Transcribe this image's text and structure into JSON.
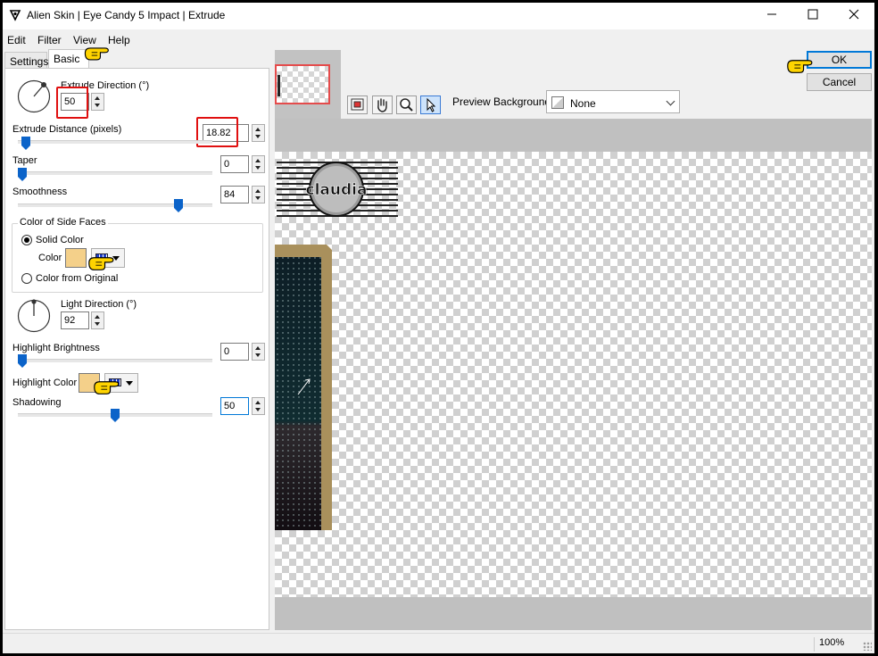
{
  "window": {
    "title": "Alien Skin | Eye Candy 5 Impact | Extrude"
  },
  "menu": [
    "Edit",
    "Filter",
    "View",
    "Help"
  ],
  "tabs": {
    "settings": "Settings",
    "basic": "Basic"
  },
  "controls": {
    "extrude_direction": {
      "label": "Extrude Direction (°)",
      "value": "50"
    },
    "extrude_distance": {
      "label": "Extrude Distance (pixels)",
      "value": "18.82",
      "slider_fraction": 0.02
    },
    "taper": {
      "label": "Taper",
      "value": "0",
      "slider_fraction": 0.0
    },
    "smoothness": {
      "label": "Smoothness",
      "value": "84",
      "slider_fraction": 0.84
    },
    "side_faces": {
      "group_label": "Color of Side Faces",
      "solid_color_label": "Solid Color",
      "color_label": "Color",
      "color": "#f4d08a",
      "from_original_label": "Color from Original"
    },
    "light_direction": {
      "label": "Light Direction (°)",
      "value": "92"
    },
    "highlight_brightness": {
      "label": "Highlight Brightness",
      "value": "0",
      "slider_fraction": 0.0
    },
    "highlight_color": {
      "label": "Highlight Color",
      "color": "#f4d08a"
    },
    "shadowing": {
      "label": "Shadowing",
      "value": "50",
      "slider_fraction": 0.5
    }
  },
  "preview_toolbar": {
    "background_label": "Preview Background:",
    "background_value": "None",
    "icons": [
      "navigator-icon",
      "hand-pan-icon",
      "zoom-magnifier-icon",
      "select-arrow-icon"
    ]
  },
  "buttons": {
    "ok": "OK",
    "cancel": "Cancel"
  },
  "preview": {
    "logo_text": "claudia"
  },
  "status": {
    "zoom": "100%"
  },
  "colors": {
    "highlight_red": "#e01010",
    "accent_blue": "#0078d7",
    "extrude_side": "#a9905c"
  }
}
